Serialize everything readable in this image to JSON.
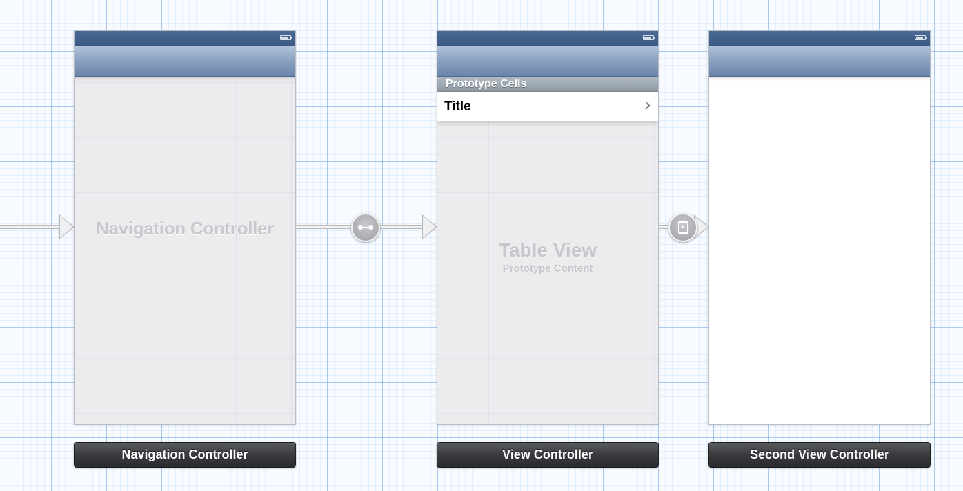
{
  "canvas": {
    "background_color": "#f7fbff",
    "grid_color": "#78aae1"
  },
  "scenes": {
    "navigation_controller": {
      "watermark": "Navigation Controller",
      "label": "Navigation Controller"
    },
    "view_controller": {
      "section_header": "Prototype Cells",
      "cell_title": "Title",
      "table_watermark": "Table View",
      "table_watermark_sub": "Prototype Content",
      "label": "View Controller"
    },
    "second_view_controller": {
      "label": "Second View Controller"
    }
  },
  "segues": {
    "relationship_icon": "relationship-icon",
    "push_icon": "push-segue-icon"
  },
  "colors": {
    "status_bar": "#3a5a84",
    "nav_bar": "#8da4c3",
    "scene_bar_label": "#2a2b2e"
  }
}
